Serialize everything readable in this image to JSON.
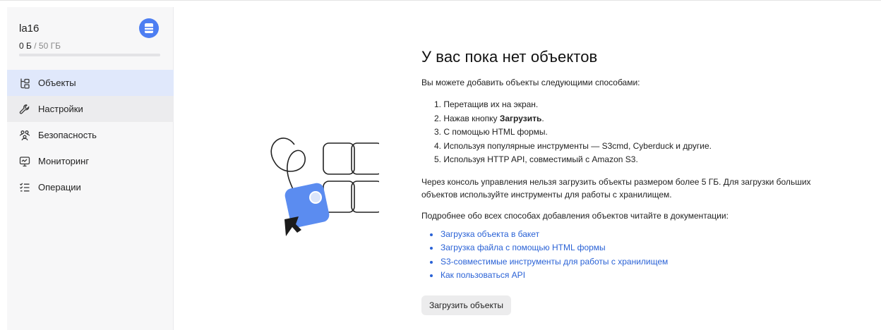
{
  "bucket": {
    "name": "la16",
    "used": "0 Б",
    "separator": " / ",
    "total": "50 ГБ",
    "icon": "bucket-icon",
    "usage_fraction": 0.0
  },
  "sidebar": {
    "items": [
      {
        "label": "Объекты",
        "icon": "objects-icon",
        "state": "active"
      },
      {
        "label": "Настройки",
        "icon": "wrench-icon",
        "state": "hover"
      },
      {
        "label": "Безопасность",
        "icon": "users-icon",
        "state": ""
      },
      {
        "label": "Мониторинг",
        "icon": "monitor-icon",
        "state": ""
      },
      {
        "label": "Операции",
        "icon": "operations-list-icon",
        "state": ""
      }
    ]
  },
  "main": {
    "title": "У вас пока нет объектов",
    "intro": "Вы можете добавить объекты следующими способами:",
    "steps": [
      {
        "prefix": "1. Перетащив их на экран.",
        "bold": "",
        "suffix": ""
      },
      {
        "prefix": "2. Нажав кнопку ",
        "bold": "Загрузить",
        "suffix": "."
      },
      {
        "prefix": "3. С помощью HTML формы.",
        "bold": "",
        "suffix": ""
      },
      {
        "prefix": "4. Используя популярные инструменты — S3cmd, Cyberduck и другие.",
        "bold": "",
        "suffix": ""
      },
      {
        "prefix": "5. Используя HTTP API, совместимый с Amazon S3.",
        "bold": "",
        "suffix": ""
      }
    ],
    "note": "Через консоль управления нельзя загрузить объекты размером более 5 ГБ. Для загрузки больших объектов используйте инструменты для работы с хранилищем.",
    "more": "Подробнее обо всех способах добавления объектов читайте в документации:",
    "links": [
      "Загрузка объекта в бакет",
      "Загрузка файла с помощью HTML формы",
      "S3-совместимые инструменты для работы с хранилищем",
      "Как пользоваться API"
    ],
    "upload_button": "Загрузить объекты"
  },
  "colors": {
    "accent": "#4d7ef2",
    "link": "#2a62d6",
    "active_bg": "#e0e8fb",
    "sidebar_bg": "#f7f7f8"
  }
}
